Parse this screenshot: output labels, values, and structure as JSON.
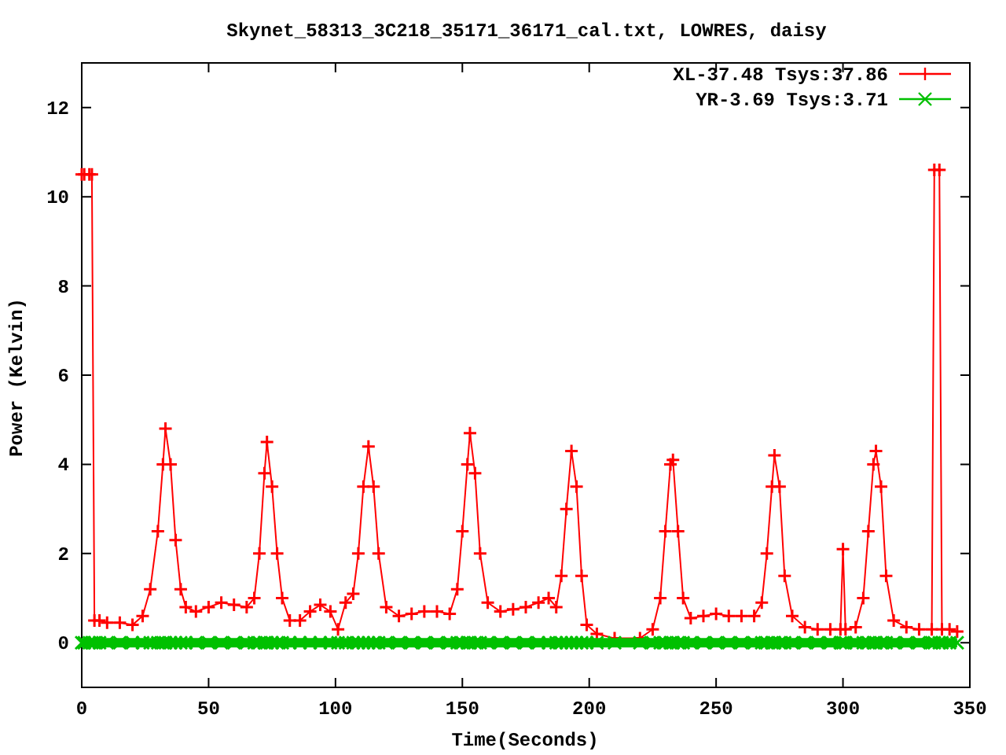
{
  "chart_data": {
    "type": "line",
    "title": "Skynet_58313_3C218_35171_36171_cal.txt, LOWRES, daisy",
    "xlabel": "Time(Seconds)",
    "ylabel": "Power (Kelvin)",
    "x": [
      0,
      1,
      3,
      4,
      5,
      7,
      10,
      15,
      20,
      24,
      27,
      30,
      32,
      33,
      35,
      37,
      39,
      41,
      45,
      50,
      55,
      60,
      65,
      68,
      70,
      72,
      73,
      75,
      77,
      79,
      82,
      86,
      90,
      94,
      98,
      101,
      104,
      107,
      109,
      111,
      113,
      115,
      117,
      120,
      125,
      130,
      135,
      140,
      145,
      148,
      150,
      152,
      153,
      155,
      157,
      160,
      165,
      170,
      175,
      180,
      184,
      187,
      189,
      191,
      193,
      195,
      197,
      199,
      203,
      210,
      220,
      225,
      228,
      230,
      232,
      233,
      235,
      237,
      240,
      245,
      250,
      255,
      260,
      265,
      268,
      270,
      272,
      273,
      275,
      277,
      280,
      285,
      290,
      295,
      299,
      300,
      301,
      305,
      308,
      310,
      312,
      313,
      315,
      317,
      320,
      325,
      330,
      335,
      336,
      338,
      339,
      342,
      345
    ],
    "series": [
      {
        "name": "XL-37.48 Tsys:37.86",
        "color": "#ff0000",
        "marker": "plus",
        "values": [
          10.5,
          10.5,
          10.5,
          10.5,
          0.5,
          0.5,
          0.45,
          0.45,
          0.4,
          0.6,
          1.2,
          2.5,
          4,
          4.8,
          4,
          2.3,
          1.2,
          0.8,
          0.7,
          0.8,
          0.9,
          0.85,
          0.8,
          1,
          2,
          3.8,
          4.5,
          3.5,
          2,
          1,
          0.5,
          0.5,
          0.7,
          0.85,
          0.7,
          0.3,
          0.9,
          1.1,
          2,
          3.5,
          4.4,
          3.5,
          2,
          0.8,
          0.6,
          0.65,
          0.7,
          0.7,
          0.65,
          1.2,
          2.5,
          4,
          4.7,
          3.8,
          2,
          0.9,
          0.7,
          0.75,
          0.8,
          0.9,
          1,
          0.8,
          1.5,
          3,
          4.3,
          3.5,
          1.5,
          0.4,
          0.2,
          0.1,
          0.1,
          0.3,
          1,
          2.5,
          4,
          4.1,
          2.5,
          1,
          0.55,
          0.6,
          0.65,
          0.6,
          0.6,
          0.6,
          0.9,
          2,
          3.5,
          4.2,
          3.5,
          1.5,
          0.6,
          0.35,
          0.3,
          0.3,
          0.3,
          2.1,
          0.3,
          0.35,
          1,
          2.5,
          4,
          4.3,
          3.5,
          1.5,
          0.5,
          0.35,
          0.3,
          0.3,
          10.6,
          10.6,
          0.3,
          0.3,
          0.25
        ]
      },
      {
        "name": "YR-3.69 Tsys:3.71",
        "color": "#00c000",
        "marker": "cross",
        "values": [
          0,
          0,
          0,
          0,
          0,
          0,
          0,
          0,
          0,
          0,
          0,
          0,
          0,
          0,
          0,
          0,
          0,
          0,
          0,
          0,
          0,
          0,
          0,
          0,
          0,
          0,
          0,
          0,
          0,
          0,
          0,
          0,
          0,
          0,
          0,
          0,
          0,
          0,
          0,
          0,
          0,
          0,
          0,
          0,
          0,
          0,
          0,
          0,
          0,
          0,
          0,
          0,
          0,
          0,
          0,
          0,
          0,
          0,
          0,
          0,
          0,
          0,
          0,
          0,
          0,
          0,
          0,
          0,
          0,
          0,
          0,
          0,
          0,
          0,
          0,
          0,
          0,
          0,
          0,
          0,
          0,
          0,
          0,
          0,
          0,
          0,
          0,
          0,
          0,
          0,
          0,
          0,
          0,
          0,
          0,
          0,
          0,
          0,
          0,
          0,
          0,
          0,
          0,
          0,
          0,
          0,
          0,
          0,
          0,
          0,
          0,
          0,
          0
        ]
      }
    ],
    "legend": "top-right",
    "xlim": [
      0,
      350
    ],
    "ylim": [
      -1,
      13
    ],
    "xticks": [
      0,
      50,
      100,
      150,
      200,
      250,
      300,
      350
    ],
    "yticks": [
      0,
      2,
      4,
      6,
      8,
      10,
      12
    ]
  }
}
